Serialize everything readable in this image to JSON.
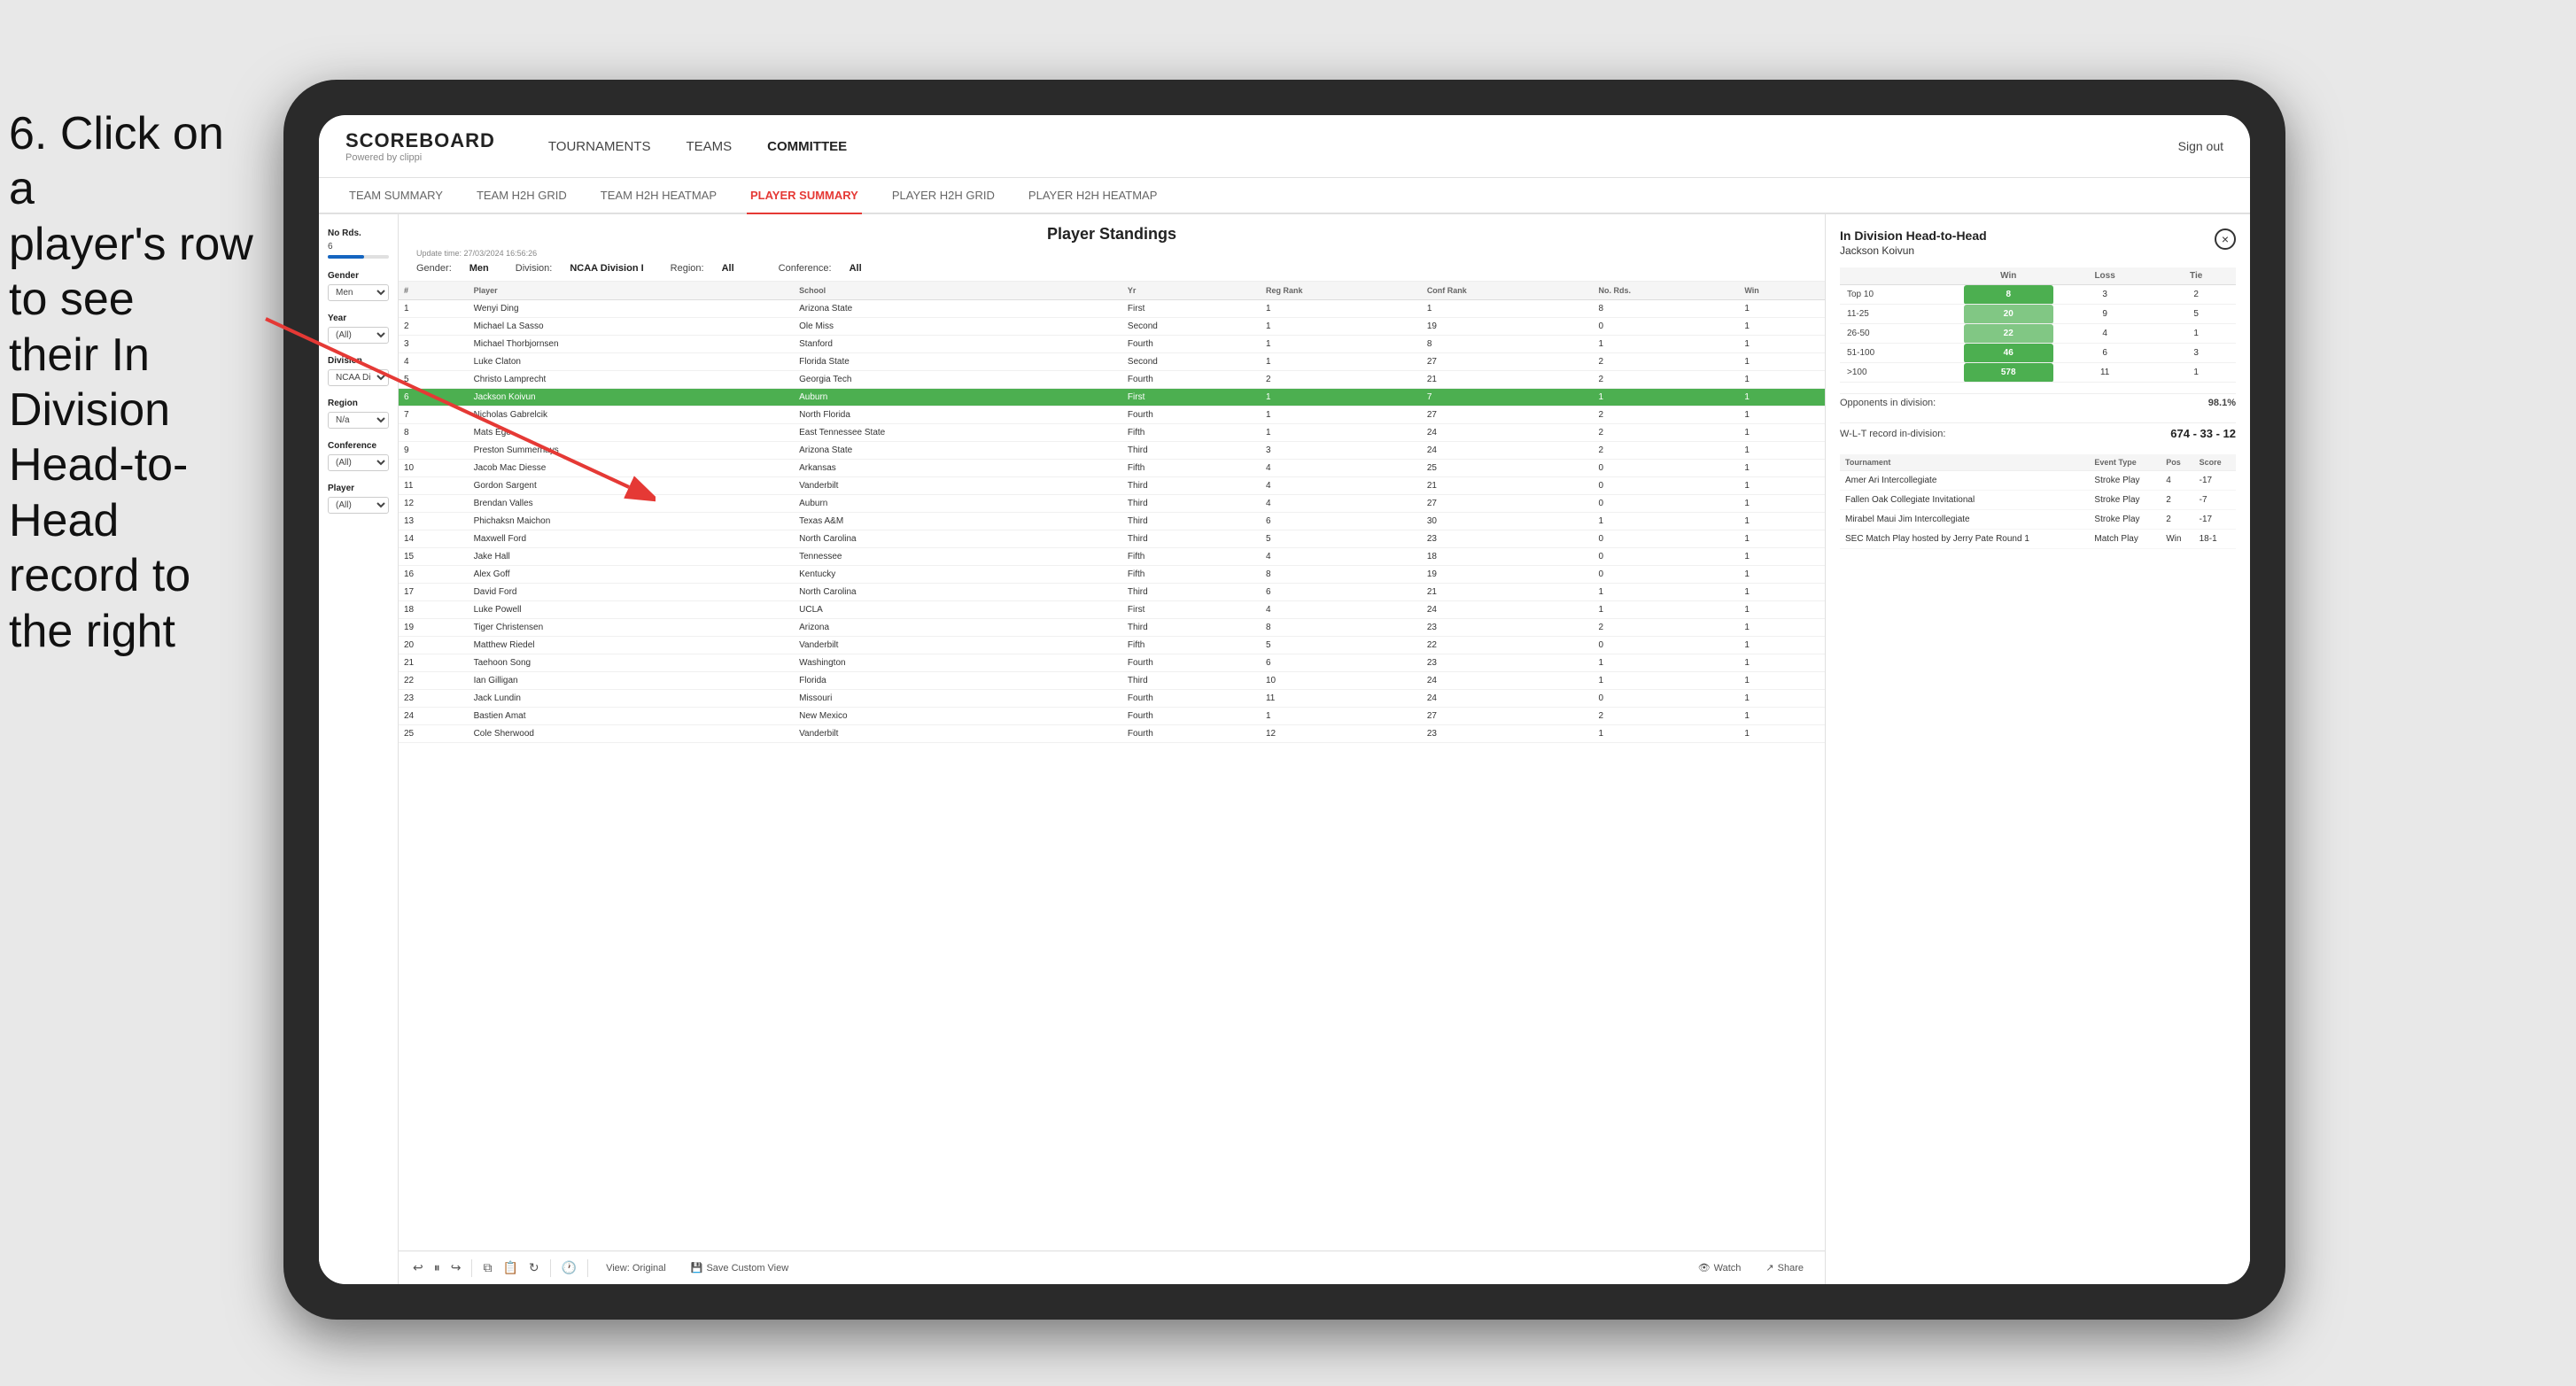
{
  "instruction": {
    "line1": "6. Click on a",
    "line2": "player's row to see",
    "line3": "their In Division",
    "line4": "Head-to-Head",
    "line5": "record to the right"
  },
  "nav": {
    "logo": "SCOREBOARD",
    "logo_sub": "Powered by clippi",
    "items": [
      "TOURNAMENTS",
      "TEAMS",
      "COMMITTEE"
    ],
    "sign_out": "Sign out"
  },
  "sub_nav": {
    "items": [
      "TEAM SUMMARY",
      "TEAM H2H GRID",
      "TEAM H2H HEATMAP",
      "PLAYER SUMMARY",
      "PLAYER H2H GRID",
      "PLAYER H2H HEATMAP"
    ],
    "active": "PLAYER SUMMARY"
  },
  "standings": {
    "title": "Player Standings",
    "update_time": "Update time:",
    "update_value": "27/03/2024 16:56:26",
    "gender_label": "Gender:",
    "gender_val": "Men",
    "division_label": "Division:",
    "division_val": "NCAA Division I",
    "region_label": "Region:",
    "region_val": "All",
    "conference_label": "Conference:",
    "conference_val": "All"
  },
  "filters": {
    "no_rds": "No Rds.",
    "no_rds_val": "6",
    "gender_label": "Gender",
    "gender_val": "Men",
    "year_label": "Year",
    "year_val": "(All)",
    "division_label": "Division",
    "division_val": "NCAA Division I",
    "region_label": "Region",
    "region_val": "N/a",
    "conference_label": "Conference",
    "conference_val": "(All)",
    "player_label": "Player",
    "player_val": "(All)"
  },
  "table": {
    "headers": [
      "#",
      "Player",
      "School",
      "Yr",
      "Reg Rank",
      "Conf Rank",
      "No. Rds.",
      "Win"
    ],
    "rows": [
      {
        "num": 1,
        "player": "Wenyi Ding",
        "school": "Arizona State",
        "yr": "First",
        "reg": 1,
        "conf": 1,
        "rds": 8,
        "win": 1,
        "selected": false
      },
      {
        "num": 2,
        "player": "Michael La Sasso",
        "school": "Ole Miss",
        "yr": "Second",
        "reg": 1,
        "conf": 19,
        "rds": 0,
        "win": 1,
        "selected": false
      },
      {
        "num": 3,
        "player": "Michael Thorbjornsen",
        "school": "Stanford",
        "yr": "Fourth",
        "reg": 1,
        "conf": 8,
        "rds": 1,
        "win": 1,
        "selected": false
      },
      {
        "num": 4,
        "player": "Luke Claton",
        "school": "Florida State",
        "yr": "Second",
        "reg": 1,
        "conf": 27,
        "rds": 2,
        "win": 1,
        "selected": false
      },
      {
        "num": 5,
        "player": "Christo Lamprecht",
        "school": "Georgia Tech",
        "yr": "Fourth",
        "reg": 2,
        "conf": 21,
        "rds": 2,
        "win": 1,
        "selected": false
      },
      {
        "num": 6,
        "player": "Jackson Koivun",
        "school": "Auburn",
        "yr": "First",
        "reg": 1,
        "conf": 7,
        "rds": 1,
        "win": 1,
        "selected": true
      },
      {
        "num": 7,
        "player": "Nicholas Gabrelcik",
        "school": "North Florida",
        "yr": "Fourth",
        "reg": 1,
        "conf": 27,
        "rds": 2,
        "win": 1,
        "selected": false
      },
      {
        "num": 8,
        "player": "Mats Ege",
        "school": "East Tennessee State",
        "yr": "Fifth",
        "reg": 1,
        "conf": 24,
        "rds": 2,
        "win": 1,
        "selected": false
      },
      {
        "num": 9,
        "player": "Preston Summerhays",
        "school": "Arizona State",
        "yr": "Third",
        "reg": 3,
        "conf": 24,
        "rds": 2,
        "win": 1,
        "selected": false
      },
      {
        "num": 10,
        "player": "Jacob Mac Diesse",
        "school": "Arkansas",
        "yr": "Fifth",
        "reg": 4,
        "conf": 25,
        "rds": 0,
        "win": 1,
        "selected": false
      },
      {
        "num": 11,
        "player": "Gordon Sargent",
        "school": "Vanderbilt",
        "yr": "Third",
        "reg": 4,
        "conf": 21,
        "rds": 0,
        "win": 1,
        "selected": false
      },
      {
        "num": 12,
        "player": "Brendan Valles",
        "school": "Auburn",
        "yr": "Third",
        "reg": 4,
        "conf": 27,
        "rds": 0,
        "win": 1,
        "selected": false
      },
      {
        "num": 13,
        "player": "Phichaksn Maichon",
        "school": "Texas A&M",
        "yr": "Third",
        "reg": 6,
        "conf": 30,
        "rds": 1,
        "win": 1,
        "selected": false
      },
      {
        "num": 14,
        "player": "Maxwell Ford",
        "school": "North Carolina",
        "yr": "Third",
        "reg": 5,
        "conf": 23,
        "rds": 0,
        "win": 1,
        "selected": false
      },
      {
        "num": 15,
        "player": "Jake Hall",
        "school": "Tennessee",
        "yr": "Fifth",
        "reg": 4,
        "conf": 18,
        "rds": 0,
        "win": 1,
        "selected": false
      },
      {
        "num": 16,
        "player": "Alex Goff",
        "school": "Kentucky",
        "yr": "Fifth",
        "reg": 8,
        "conf": 19,
        "rds": 0,
        "win": 1,
        "selected": false
      },
      {
        "num": 17,
        "player": "David Ford",
        "school": "North Carolina",
        "yr": "Third",
        "reg": 6,
        "conf": 21,
        "rds": 1,
        "win": 1,
        "selected": false
      },
      {
        "num": 18,
        "player": "Luke Powell",
        "school": "UCLA",
        "yr": "First",
        "reg": 4,
        "conf": 24,
        "rds": 1,
        "win": 1,
        "selected": false
      },
      {
        "num": 19,
        "player": "Tiger Christensen",
        "school": "Arizona",
        "yr": "Third",
        "reg": 8,
        "conf": 23,
        "rds": 2,
        "win": 1,
        "selected": false
      },
      {
        "num": 20,
        "player": "Matthew Riedel",
        "school": "Vanderbilt",
        "yr": "Fifth",
        "reg": 5,
        "conf": 22,
        "rds": 0,
        "win": 1,
        "selected": false
      },
      {
        "num": 21,
        "player": "Taehoon Song",
        "school": "Washington",
        "yr": "Fourth",
        "reg": 6,
        "conf": 23,
        "rds": 1,
        "win": 1,
        "selected": false
      },
      {
        "num": 22,
        "player": "Ian Gilligan",
        "school": "Florida",
        "yr": "Third",
        "reg": 10,
        "conf": 24,
        "rds": 1,
        "win": 1,
        "selected": false
      },
      {
        "num": 23,
        "player": "Jack Lundin",
        "school": "Missouri",
        "yr": "Fourth",
        "reg": 11,
        "conf": 24,
        "rds": 0,
        "win": 1,
        "selected": false
      },
      {
        "num": 24,
        "player": "Bastien Amat",
        "school": "New Mexico",
        "yr": "Fourth",
        "reg": 1,
        "conf": 27,
        "rds": 2,
        "win": 1,
        "selected": false
      },
      {
        "num": 25,
        "player": "Cole Sherwood",
        "school": "Vanderbilt",
        "yr": "Fourth",
        "reg": 12,
        "conf": 23,
        "rds": 1,
        "win": 1,
        "selected": false
      }
    ]
  },
  "toolbar": {
    "view_original": "View: Original",
    "save_custom": "Save Custom View",
    "watch": "Watch",
    "share": "Share"
  },
  "h2h": {
    "title": "In Division Head-to-Head",
    "player": "Jackson Koivun",
    "close_icon": "×",
    "headers": [
      "",
      "Win",
      "Loss",
      "Tie"
    ],
    "rows": [
      {
        "label": "Top 10",
        "win": 8,
        "loss": 3,
        "tie": 2,
        "win_class": "green"
      },
      {
        "label": "11-25",
        "win": 20,
        "loss": 9,
        "tie": 5,
        "win_class": "green-light"
      },
      {
        "label": "26-50",
        "win": 22,
        "loss": 4,
        "tie": 1,
        "win_class": "green-light"
      },
      {
        "label": "51-100",
        "win": 46,
        "loss": 6,
        "tie": 3,
        "win_class": "green"
      },
      {
        "label": ">100",
        "win": 578,
        "loss": 11,
        "tie": 1,
        "win_class": "green"
      }
    ],
    "opponents_label": "Opponents in division:",
    "opponents_pct": "98.1%",
    "wlt_label": "W-L-T record in-division:",
    "wlt_record": "674 - 33 - 12",
    "tournament_headers": [
      "Tournament",
      "Event Type",
      "Pos",
      "Score"
    ],
    "tournaments": [
      {
        "name": "Amer Ari Intercollegiate",
        "type": "Stroke Play",
        "pos": 4,
        "score": "-17"
      },
      {
        "name": "Fallen Oak Collegiate Invitational",
        "type": "Stroke Play",
        "pos": 2,
        "score": "-7"
      },
      {
        "name": "Mirabel Maui Jim Intercollegiate",
        "type": "Stroke Play",
        "pos": 2,
        "score": "-17"
      },
      {
        "name": "SEC Match Play hosted by Jerry Pate Round 1",
        "type": "Match Play",
        "pos": "Win",
        "score": "18-1"
      }
    ]
  },
  "colors": {
    "accent_red": "#e53935",
    "green": "#4CAF50",
    "green_light": "#81C784",
    "selected_row": "#4CAF50",
    "nav_active": "#e53935"
  }
}
